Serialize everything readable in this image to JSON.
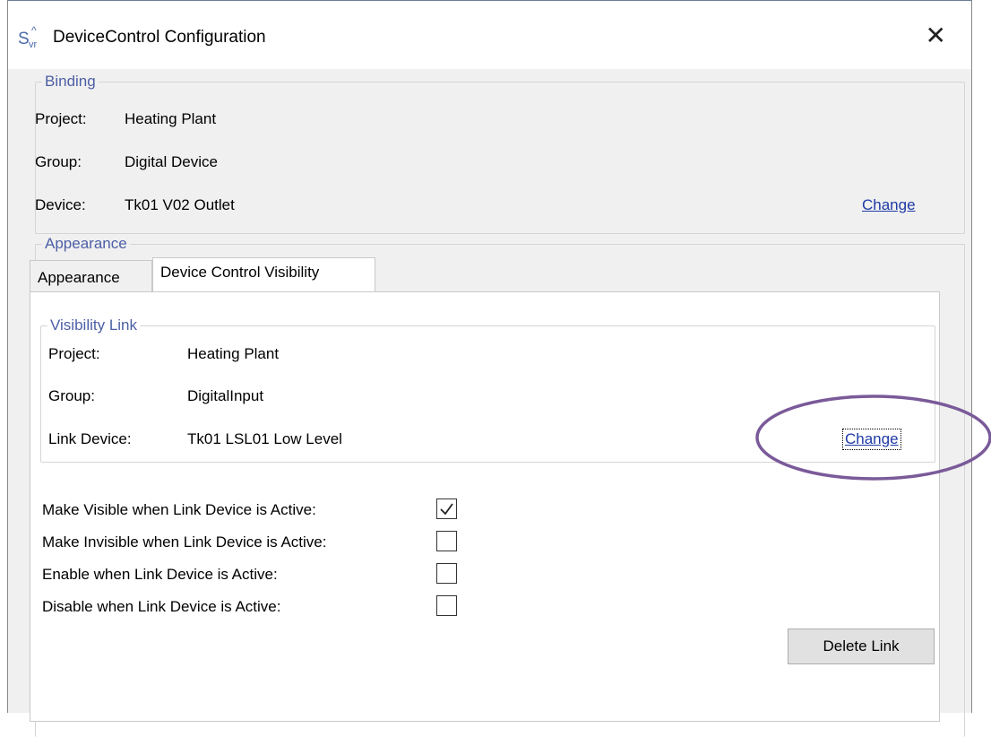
{
  "window": {
    "title": "DeviceControl Configuration",
    "close_glyph": "✕",
    "icon_letter": "S",
    "icon_sub": "vr"
  },
  "binding": {
    "legend": "Binding",
    "project_label": "Project:",
    "project_value": "Heating Plant",
    "group_label": "Group:",
    "group_value": "Digital Device",
    "device_label": "Device:",
    "device_value": "Tk01 V02 Outlet",
    "change_link": "Change"
  },
  "appearance": {
    "legend": "Appearance",
    "tabs": [
      {
        "label": "Appearance",
        "active": false
      },
      {
        "label": "Device Control Visibility",
        "active": true
      }
    ]
  },
  "visibility_link": {
    "legend": "Visibility Link",
    "project_label": "Project:",
    "project_value": "Heating Plant",
    "group_label": "Group:",
    "group_value": "DigitalInput",
    "link_device_label": "Link Device:",
    "link_device_value": "Tk01 LSL01 Low Level",
    "change_link": "Change"
  },
  "options": [
    {
      "label": "Make Visible when Link Device is Active:",
      "checked": true
    },
    {
      "label": "Make Invisible when Link Device is Active:",
      "checked": false
    },
    {
      "label": "Enable when Link Device is Active:",
      "checked": false
    },
    {
      "label": "Disable when Link Device is Active:",
      "checked": false
    }
  ],
  "delete_button": "Delete Link",
  "colors": {
    "legend": "#4c5fa5",
    "link": "#1f3aa6",
    "highlight_ellipse": "#7a5a99"
  }
}
